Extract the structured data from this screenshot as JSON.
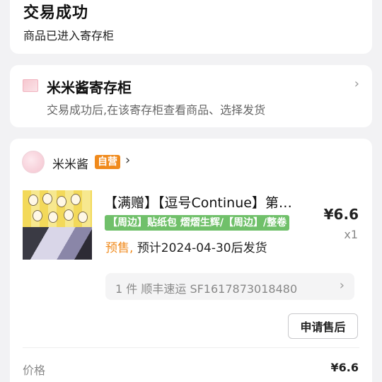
{
  "status": {
    "title": "交易成功",
    "subtitle": "商品已进入寄存柜"
  },
  "locker": {
    "logo_text": "米米酱",
    "title": "米米酱寄存柜",
    "description": "交易成功后,在该寄存柜查看商品、选择发货",
    "chevron": "›"
  },
  "shop": {
    "avatar_text": "米米酱",
    "name": "米米酱",
    "badge": "自营",
    "chevron": "›"
  },
  "product": {
    "title": "【满赠】【逗号Continue】第…",
    "tag": "【周边】贴纸包 熠熠生辉/【周边】/整卷",
    "presale_label": "预售,",
    "presale_text": "预计2024-04-30后发货",
    "price": "¥6.6",
    "quantity": "x1"
  },
  "shipping": {
    "text": "1 件 顺丰速运 SF1617873018480",
    "chevron": "›"
  },
  "actions": {
    "aftersale_label": "申请售后"
  },
  "summary": {
    "price_label": "价格",
    "price_value": "¥6.6"
  },
  "colors": {
    "accent_orange": "#f08a1c",
    "tag_green": "#70c06a",
    "background": "#f2f2f4"
  }
}
